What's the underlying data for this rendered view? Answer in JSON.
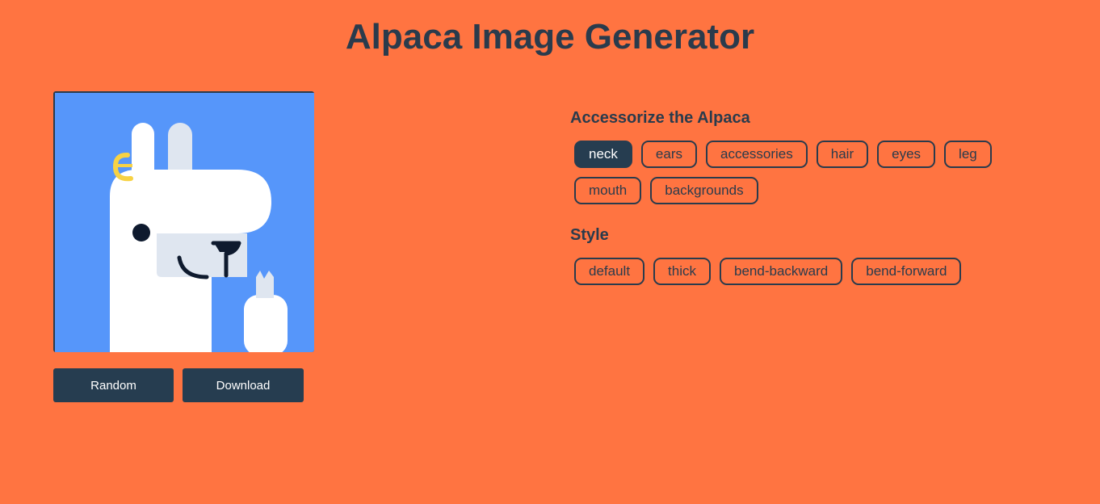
{
  "header": {
    "title": "Alpaca Image Generator"
  },
  "preview": {
    "background_color": "#5696fa",
    "alpaca_color": "#ffffff",
    "accent_color": "#dfe6f0",
    "earring_color": "#f7d244"
  },
  "actions": {
    "random_label": "Random",
    "download_label": "Download"
  },
  "accessorize": {
    "heading": "Accessorize the Alpaca",
    "options": [
      {
        "label": "neck",
        "active": true
      },
      {
        "label": "ears",
        "active": false
      },
      {
        "label": "accessories",
        "active": false
      },
      {
        "label": "hair",
        "active": false
      },
      {
        "label": "eyes",
        "active": false
      },
      {
        "label": "leg",
        "active": false
      },
      {
        "label": "mouth",
        "active": false
      },
      {
        "label": "backgrounds",
        "active": false
      }
    ]
  },
  "style": {
    "heading": "Style",
    "options": [
      {
        "label": "default"
      },
      {
        "label": "thick"
      },
      {
        "label": "bend-backward"
      },
      {
        "label": "bend-forward"
      }
    ]
  },
  "colors": {
    "page_background": "#ff7441",
    "primary_dark": "#263d50",
    "text_dark": "#2a3b4c"
  }
}
